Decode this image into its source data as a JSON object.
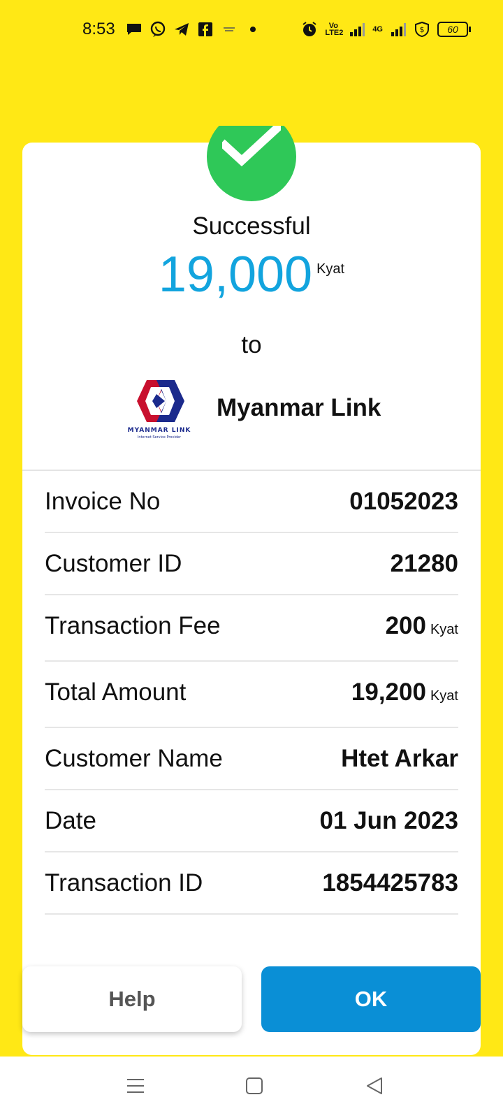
{
  "status_bar": {
    "time": "8:53",
    "battery": "60",
    "left_icons": [
      "message-icon",
      "viber-icon",
      "telegram-icon",
      "facebook-icon",
      "notification-icon",
      "dot-icon"
    ],
    "right_icons": [
      "alarm-icon",
      "volte-icon",
      "signal-icon",
      "signal-4g-icon",
      "shield-icon",
      "battery-icon"
    ],
    "network_label": "4G",
    "volte_label": "Vo LTE2"
  },
  "receipt": {
    "status": "Successful",
    "amount": "19,000",
    "amount_unit": "Kyat",
    "to_label": "to",
    "merchant_name": "Myanmar Link",
    "merchant_logo_text": "MYANMAR LINK",
    "merchant_logo_subtext": "Internet Service Provider"
  },
  "details": [
    {
      "label": "Invoice No",
      "value": "01052023",
      "unit": ""
    },
    {
      "label": "Customer ID",
      "value": "21280",
      "unit": ""
    },
    {
      "label": "Transaction Fee",
      "value": "200",
      "unit": "Kyat"
    },
    {
      "label": "Total Amount",
      "value": "19,200",
      "unit": "Kyat"
    },
    {
      "label": "Customer Name",
      "value": "Htet Arkar",
      "unit": ""
    },
    {
      "label": "Date",
      "value": "01 Jun 2023",
      "unit": ""
    },
    {
      "label": "Transaction ID",
      "value": "1854425783",
      "unit": ""
    }
  ],
  "buttons": {
    "help": "Help",
    "ok": "OK"
  },
  "colors": {
    "background": "#FFE815",
    "accent_blue": "#12A4DE",
    "success_green": "#2FC858",
    "ok_button": "#0A8FD6"
  },
  "nav_bar": [
    "menu-icon",
    "home-square-icon",
    "back-triangle-icon"
  ]
}
